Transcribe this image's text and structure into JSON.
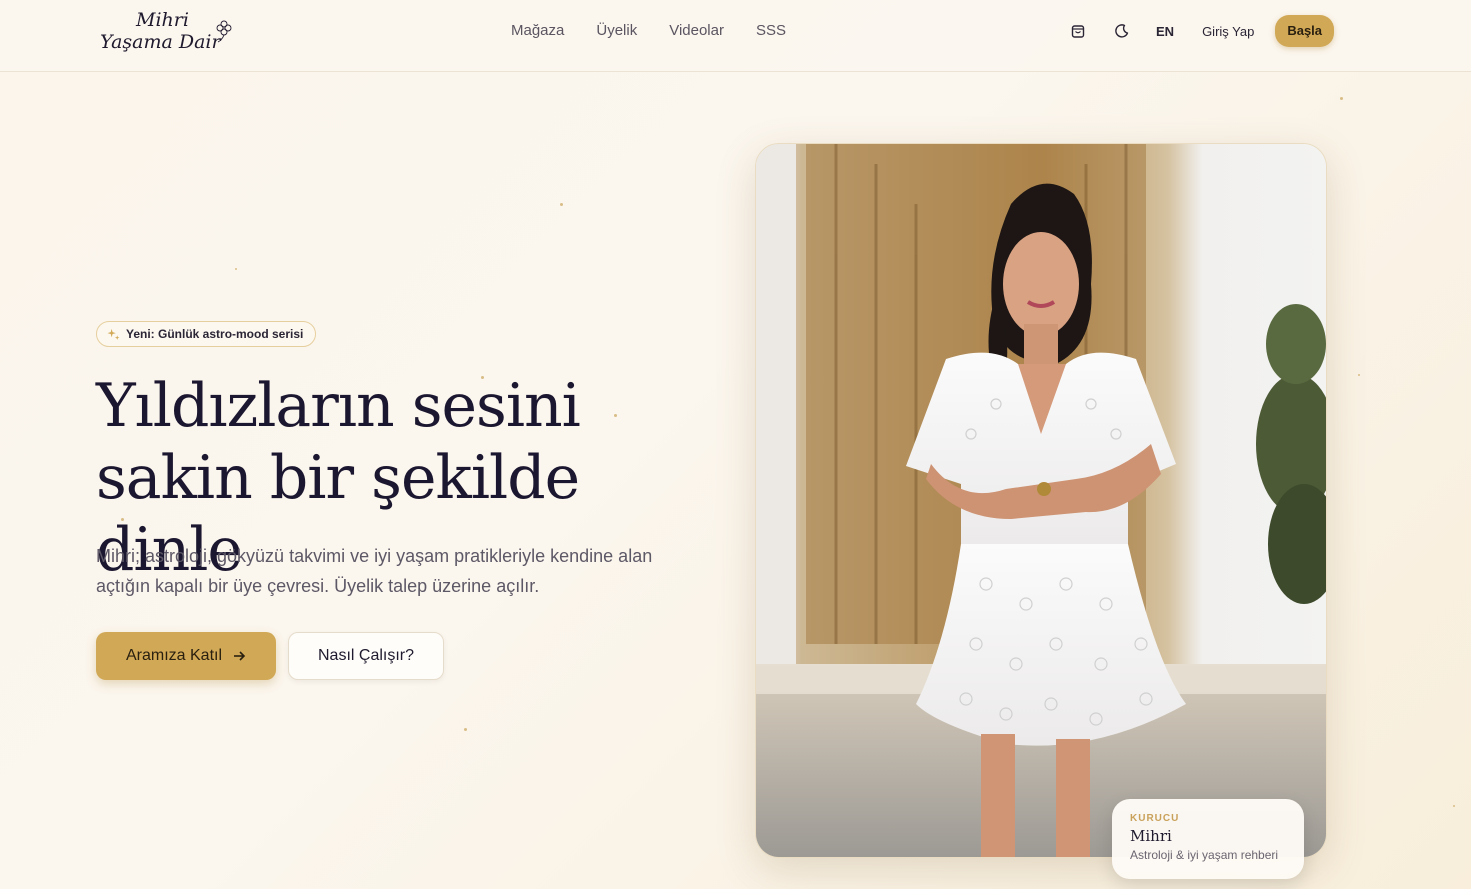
{
  "brand": {
    "logo_line1": "Mihri",
    "logo_line2": "Yaşama Dair"
  },
  "nav": {
    "items": [
      "Mağaza",
      "Üyelik",
      "Videolar",
      "SSS"
    ]
  },
  "header_tools": {
    "cart_icon": "shopping-bag-icon",
    "theme_icon": "moon-icon",
    "lang_label": "EN",
    "login_label": "Giriş Yap",
    "start_label": "Başla"
  },
  "hero": {
    "badge_icon": "sparkles-icon",
    "badge_text": "Yeni: Günlük astro-mood serisi",
    "headline_line1": "Yıldızların sesini",
    "headline_line2": "sakin bir şekilde dinle",
    "subtext": "Mihri; astroloji, gökyüzü takvimi ve iyi yaşam pratikleriyle kendine alan açtığın kapalı bir üye çevresi. Üyelik talep üzerine açılır.",
    "cta_primary": "Aramıza Katıl",
    "cta_secondary": "Nasıl Çalışır?"
  },
  "founder": {
    "role": "KURUCU",
    "name": "Mihri",
    "description": "Astroloji & iyi yaşam rehberi"
  },
  "colors": {
    "accent": "#d1a855",
    "background": "#fbf6ee",
    "heading": "#1c1730",
    "body_text": "#5d5866"
  }
}
